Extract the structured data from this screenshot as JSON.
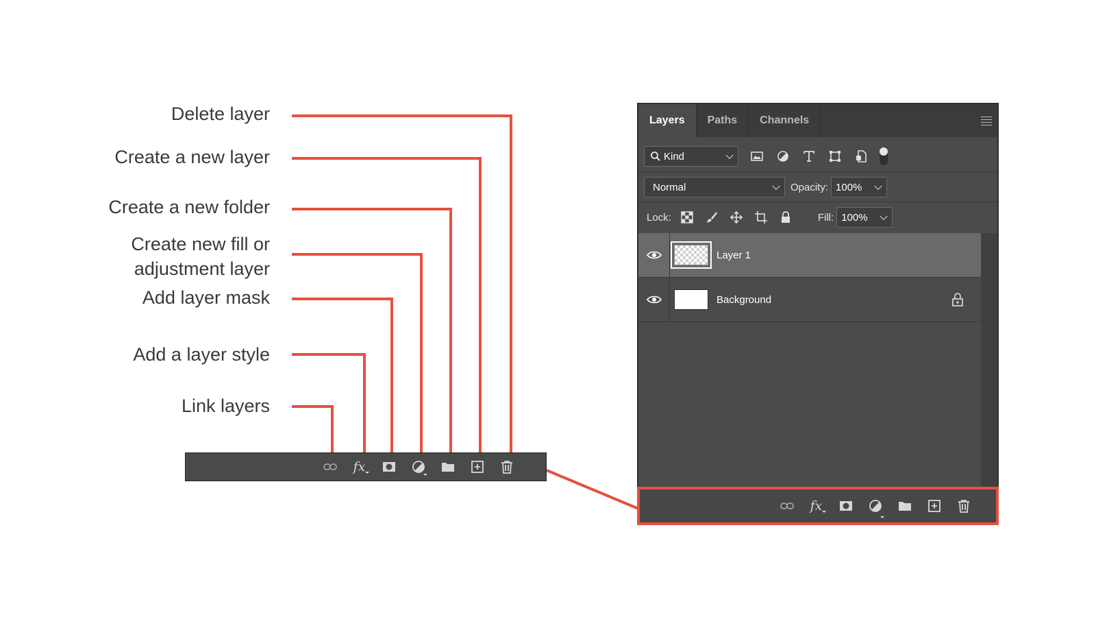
{
  "callouts": {
    "delete_layer": "Delete layer",
    "create_new_layer": "Create a new layer",
    "create_new_folder": "Create a new folder",
    "fill_adjustment_line1": "Create new fill or",
    "fill_adjustment_line2": "adjustment layer",
    "add_layer_mask": "Add layer mask",
    "add_layer_style": "Add a layer style",
    "link_layers": "Link layers"
  },
  "toolbar": {
    "fx_label": "fx",
    "icons": [
      "link-icon",
      "fx-icon",
      "layer-mask-icon",
      "adjustment-icon",
      "folder-icon",
      "new-layer-icon",
      "trash-icon"
    ]
  },
  "panel": {
    "tabs": [
      {
        "label": "Layers",
        "active": true
      },
      {
        "label": "Paths",
        "active": false
      },
      {
        "label": "Channels",
        "active": false
      }
    ],
    "filter_kind": "Kind",
    "blend_mode": "Normal",
    "opacity_label": "Opacity:",
    "opacity_value": "100%",
    "lock_label": "Lock:",
    "fill_label": "Fill:",
    "fill_value": "100%",
    "layers": [
      {
        "name": "Layer 1",
        "selected": true,
        "locked": false
      },
      {
        "name": "Background",
        "selected": false,
        "locked": true
      }
    ]
  },
  "colors": {
    "accent": "#e5513f",
    "panel_bg": "#4b4b4b",
    "tab_bar_bg": "#3b3b3b",
    "selected_row": "#6a6a6a"
  }
}
